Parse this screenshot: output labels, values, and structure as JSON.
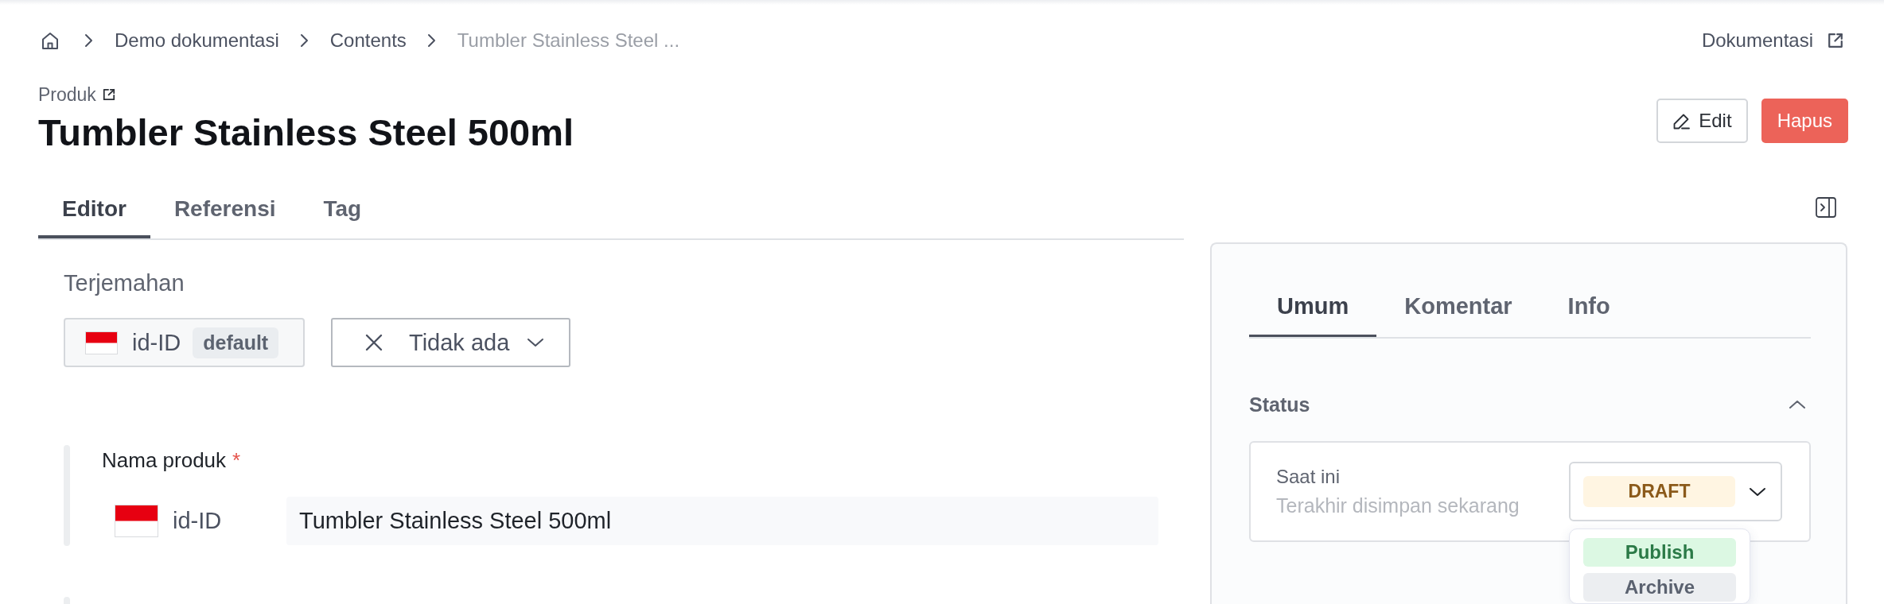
{
  "breadcrumb": [
    {
      "label": "Demo dokumentasi",
      "current": false
    },
    {
      "label": "Contents",
      "current": false
    },
    {
      "label": "Tumbler Stainless Steel ...",
      "current": true
    }
  ],
  "header_link": {
    "label": "Dokumentasi"
  },
  "header": {
    "content_type": "Produk",
    "title": "Tumbler Stainless Steel 500ml",
    "actions": [
      {
        "label": "Edit",
        "kind": "edit"
      },
      {
        "label": "Hapus",
        "kind": "delete"
      }
    ]
  },
  "tabs": [
    {
      "label": "Editor",
      "selected": true
    },
    {
      "label": "Referensi",
      "selected": false
    },
    {
      "label": "Tag",
      "selected": false
    }
  ],
  "translation": {
    "label": "Terjemahan",
    "locale": "id-ID",
    "badge": "default",
    "select": {
      "value": "Tidak ada"
    }
  },
  "fields": [
    {
      "label": "Nama produk",
      "required_mark": "*",
      "entries": [
        {
          "locale": "id-ID",
          "value": "Tumbler Stainless Steel 500ml"
        }
      ]
    }
  ],
  "side_panel": {
    "tabs": [
      {
        "label": "Umum",
        "selected": true
      },
      {
        "label": "Komentar",
        "selected": false
      },
      {
        "label": "Info",
        "selected": false
      }
    ],
    "status": {
      "heading": "Status",
      "expanded": true,
      "label": "Saat ini",
      "note": "Terakhir disimpan sekarang",
      "current": {
        "label": "DRAFT",
        "kind": "draft"
      },
      "open": true,
      "options": [
        {
          "label": "Publish",
          "kind": "publish"
        },
        {
          "label": "Archive",
          "kind": "archive"
        }
      ]
    }
  }
}
